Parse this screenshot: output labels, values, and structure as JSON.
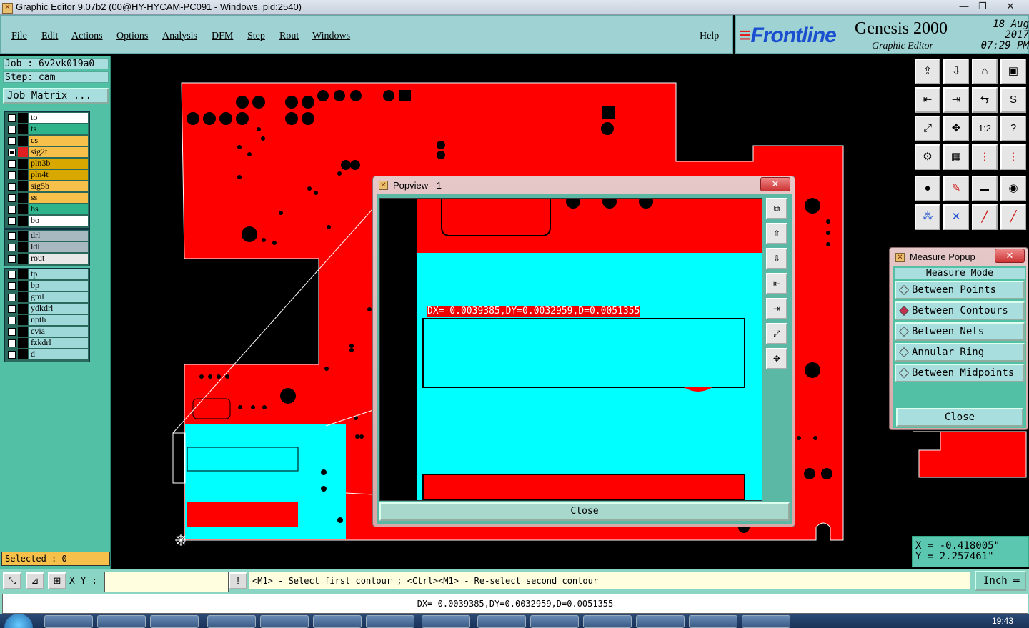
{
  "window": {
    "title": "Graphic Editor 9.07b2 (00@HY-HYCAM-PC091 - Windows, pid:2540)"
  },
  "menu": {
    "items": [
      "File",
      "Edit",
      "Actions",
      "Options",
      "Analysis",
      "DFM",
      "Step",
      "Rout",
      "Windows"
    ],
    "help": "Help"
  },
  "brand": {
    "logo": "Frontline",
    "product": "Genesis 2000",
    "subtitle": "Graphic Editor",
    "date": "18 Aug 2017",
    "time": "07:29 PM"
  },
  "job": {
    "job_label": "Job  :  6v2vk019a0",
    "step_label": "Step:  cam",
    "matrix_button": "Job Matrix ..."
  },
  "layers": {
    "group1": [
      {
        "name": "to",
        "color": "#ffffff",
        "checked": false
      },
      {
        "name": "ts",
        "color": "#2fb38a",
        "checked": false
      },
      {
        "name": "cs",
        "color": "#f6c04a",
        "checked": false
      },
      {
        "name": "sig2t",
        "color": "#f6c04a",
        "checked": true
      },
      {
        "name": "pln3b",
        "color": "#d8a800",
        "checked": false
      },
      {
        "name": "pln4t",
        "color": "#d8a800",
        "checked": false
      },
      {
        "name": "sig5b",
        "color": "#f6c04a",
        "checked": false
      },
      {
        "name": "ss",
        "color": "#f6c04a",
        "checked": false
      },
      {
        "name": "bs",
        "color": "#2fb38a",
        "checked": false
      },
      {
        "name": "bo",
        "color": "#ffffff",
        "checked": false
      }
    ],
    "group2": [
      {
        "name": "drl",
        "color": "#a8b8c0",
        "checked": false
      },
      {
        "name": "ldi",
        "color": "#a8b8c0",
        "checked": false
      },
      {
        "name": "rout",
        "color": "#e8e8e8",
        "checked": false
      }
    ],
    "group3": [
      {
        "name": "tp",
        "color": "#9ed8d8",
        "checked": false
      },
      {
        "name": "bp",
        "color": "#9ed8d8",
        "checked": false
      },
      {
        "name": "gml",
        "color": "#9ed8d8",
        "checked": false
      },
      {
        "name": "ydkdrl",
        "color": "#9ed8d8",
        "checked": false
      },
      {
        "name": "npth",
        "color": "#9ed8d8",
        "checked": false
      },
      {
        "name": "cvia",
        "color": "#9ed8d8",
        "checked": false
      },
      {
        "name": "fzkdrl",
        "color": "#9ed8d8",
        "checked": false
      },
      {
        "name": "d",
        "color": "#9ed8d8",
        "checked": false
      }
    ]
  },
  "selected": "Selected : 0",
  "popview": {
    "title": "Popview - 1",
    "measure_readout": "DX=-0.0039385,DY=0.0032959,D=0.0051355",
    "close": "Close"
  },
  "measure_popup": {
    "title": "Measure Popup",
    "header": "Measure Mode",
    "options": [
      "Between Points",
      "Between Contours",
      "Between Nets",
      "Annular Ring",
      "Between Midpoints"
    ],
    "selected_option": "Between Contours",
    "close": "Close"
  },
  "coords": {
    "x": "X = -0.418005\"",
    "y": "Y = 2.257461\""
  },
  "cmd": {
    "xy_label": "X Y :",
    "prompt": "<M1> - Select first contour ; <Ctrl><M1> - Re-select second contour",
    "units": "Inch"
  },
  "status": {
    "text": "DX=-0.0039385,DY=0.0032959,D=0.0051355"
  },
  "taskbar": {
    "clock": "19:43"
  },
  "colors": {
    "copper": "#ff0000",
    "highlight": "#00ffff",
    "panel": "#52c0a5"
  }
}
